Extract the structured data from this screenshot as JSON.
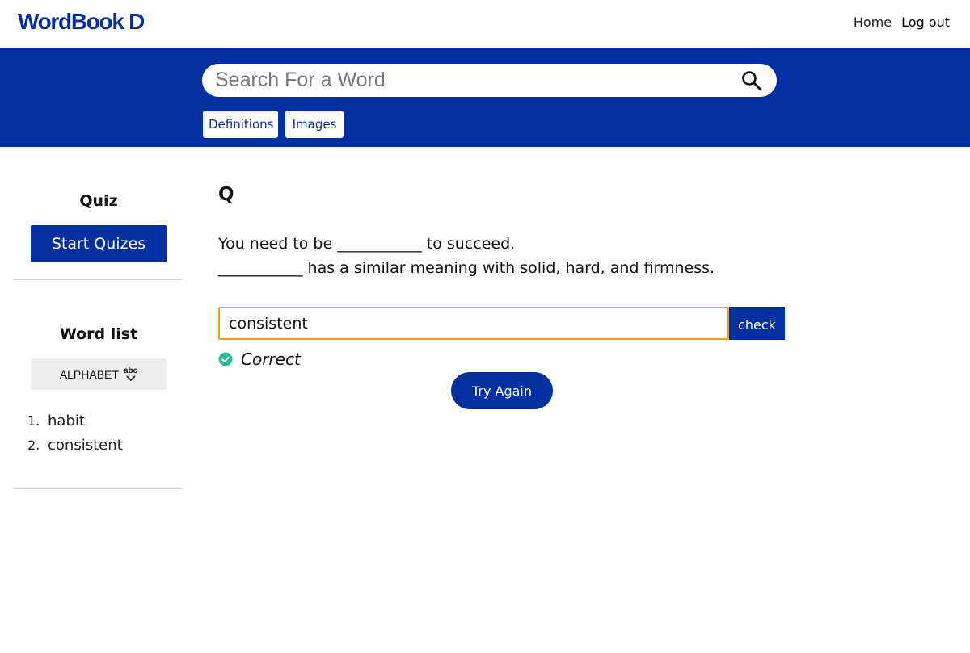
{
  "header": {
    "logo_text": "WordBook D",
    "nav": {
      "home": "Home",
      "logout": "Log out"
    }
  },
  "search": {
    "placeholder": "Search For a Word",
    "value": "",
    "icon": "search-icon",
    "modes": {
      "definitions": "Definitions",
      "images": "Images"
    }
  },
  "sidebar": {
    "quiz_title": "Quiz",
    "start_button": "Start Quizes",
    "wordlist_title": "Word list",
    "sort_button": "ALPHABET",
    "sort_icon": "sort-alphabet-icon",
    "sort_icon_text": "abc",
    "words": [
      {
        "number": "1.",
        "word": "habit"
      },
      {
        "number": "2.",
        "word": "consistent"
      }
    ]
  },
  "quiz": {
    "heading": "Q",
    "line1": "You need to be ___________ to succeed.",
    "line2": "___________ has a similar meaning with solid, hard, and firmness.",
    "answer_value": "consistent",
    "check_button": "check",
    "result_text": "Correct",
    "result_icon": "check-circle-icon",
    "try_again_button": "Try Again"
  },
  "colors": {
    "brand_blue": "#0330a0",
    "logo_blue": "#0a2e9c",
    "input_focus_border": "#f0a21a",
    "correct_green": "#2dbb95"
  }
}
